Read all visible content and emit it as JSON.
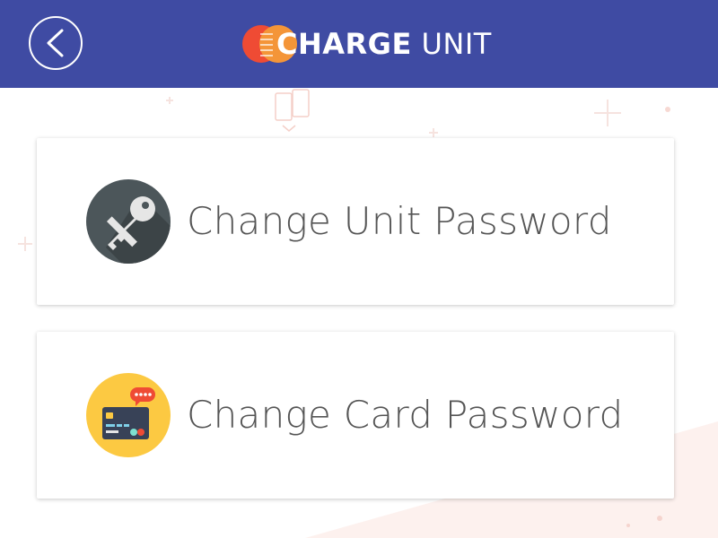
{
  "header": {
    "back_icon": "chevron-left-icon",
    "logo_bold": "CHARGE",
    "logo_light": "UNIT",
    "background_color": "#3f4ba3"
  },
  "options": [
    {
      "label": "Change Unit Password",
      "icon": "key-icon",
      "icon_color": "#4c565a"
    },
    {
      "label": "Change Card Password",
      "icon": "credit-card-icon",
      "icon_color": "#fcc942"
    }
  ],
  "colors": {
    "logo_red": "#ef4b34",
    "logo_orange": "#f7a33b",
    "decor_pink": "#fbe4df"
  }
}
